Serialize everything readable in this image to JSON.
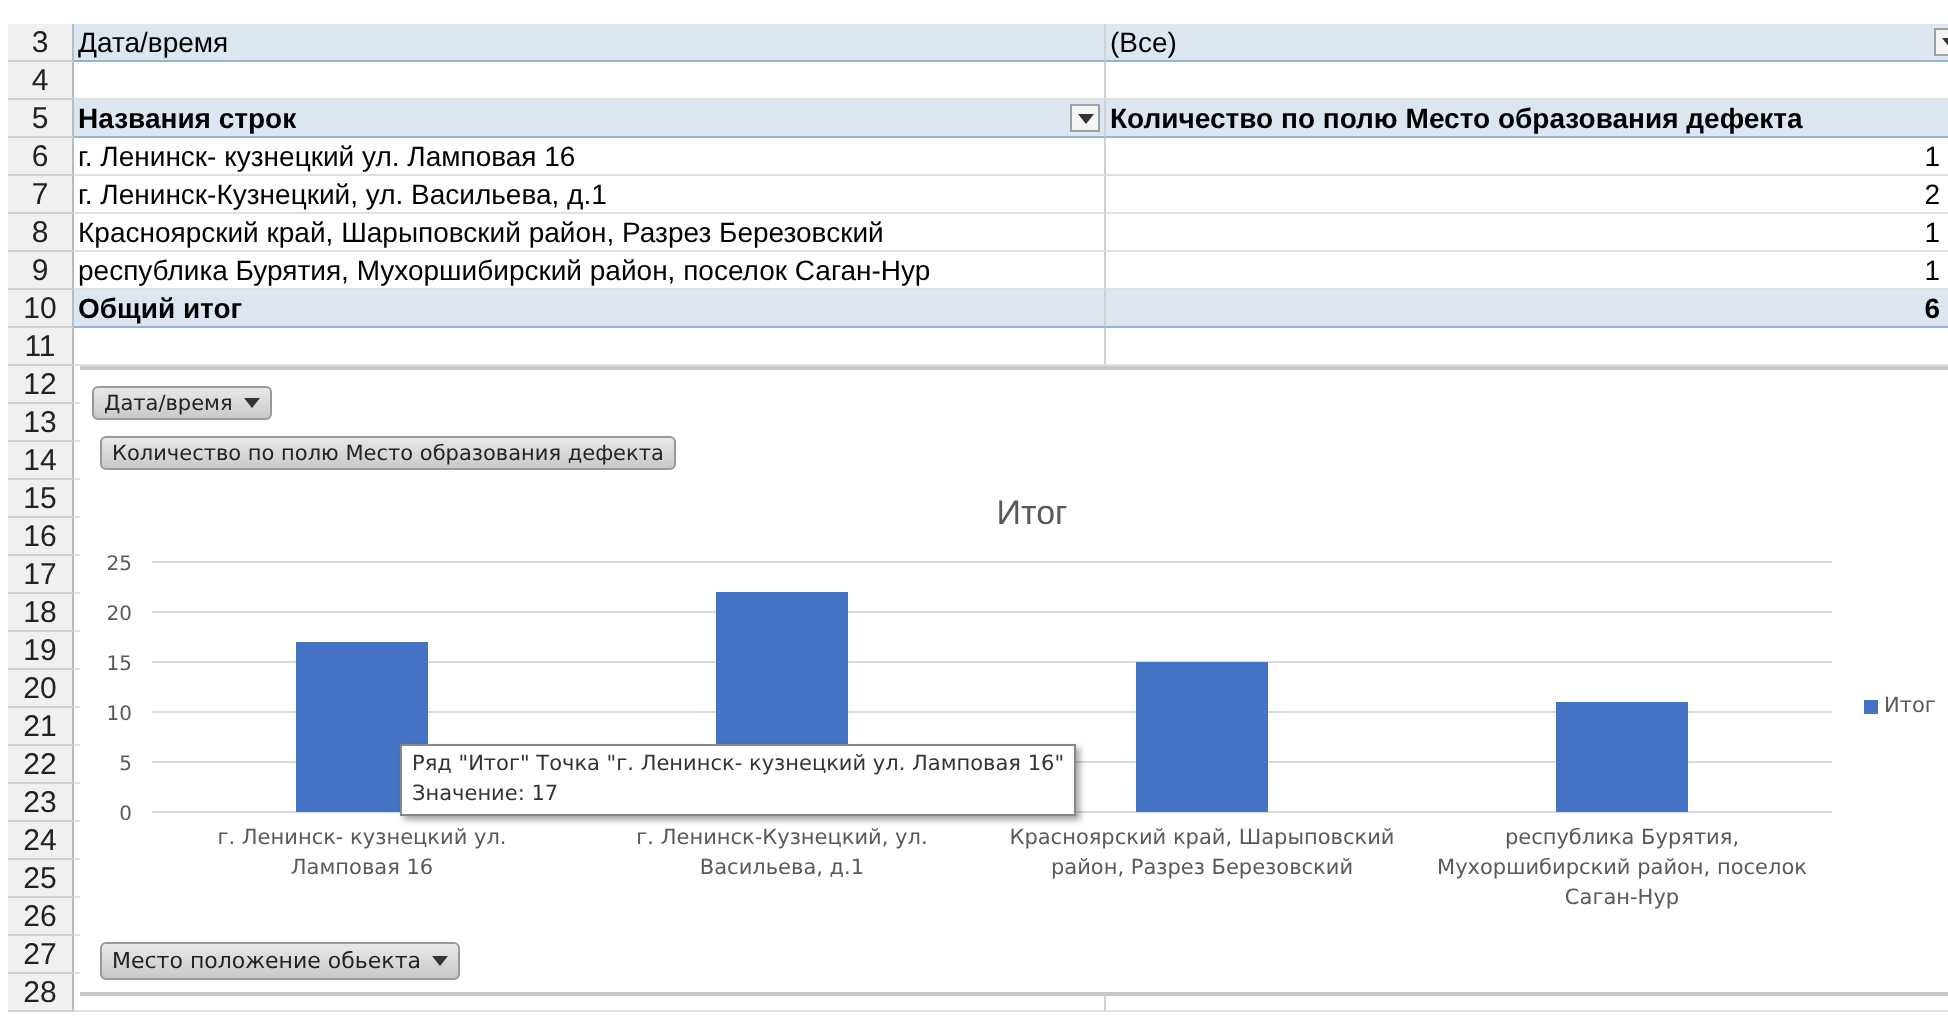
{
  "sheet": {
    "row_numbers": [
      "3",
      "4",
      "5",
      "6",
      "7",
      "8",
      "9",
      "10",
      "11",
      "12",
      "13",
      "14",
      "15",
      "16",
      "17",
      "18",
      "19",
      "20",
      "21",
      "22",
      "23",
      "24",
      "25",
      "26",
      "27",
      "28"
    ],
    "filter": {
      "label": "Дата/время",
      "value": "(Все)"
    },
    "header": {
      "row_label": "Названия строк",
      "value_label": "Количество по полю Место образования дефекта"
    },
    "rows": [
      {
        "label": "г. Ленинск- кузнецкий ул.  Ламповая 16",
        "value": "1"
      },
      {
        "label": "г. Ленинск-Кузнецкий, ул. Васильева, д.1",
        "value": "2"
      },
      {
        "label": "Красноярский край, Шарыповский район, Разрез Березовский",
        "value": "1"
      },
      {
        "label": "республика Бурятия, Мухоршибирский район, поселок Саган-Нур",
        "value": "1"
      }
    ],
    "total": {
      "label": "Общий итог",
      "value": "6"
    }
  },
  "pivot_chart": {
    "field_buttons": [
      {
        "label": "Дата/время",
        "dropdown": true
      },
      {
        "label": "Количество по полю Место образования дефекта",
        "dropdown": false
      }
    ],
    "chart_data": {
      "type": "bar",
      "title": "Итог",
      "categories": [
        "г. Ленинск- кузнецкий ул.  Ламповая 16",
        "г. Ленинск-Кузнецкий, ул. Васильева, д.1",
        "Красноярский край, Шарыповский район, Разрез Березовский",
        "республика Бурятия, Мухоршибирский район, поселок Саган-Нур"
      ],
      "series": [
        {
          "name": "Итог",
          "color": "#4472c4",
          "values": [
            17,
            22,
            15,
            11
          ]
        }
      ],
      "ylim": [
        0,
        25
      ],
      "grid": true,
      "yticks": [
        0,
        5,
        10,
        15,
        20,
        25
      ]
    },
    "tooltip": {
      "lines": [
        "Ряд \"Итог\" Точка \"г. Ленинск- кузнецкий ул.  Ламповая 16\"",
        "Значение: 17"
      ]
    },
    "axis_button": {
      "label": "Место положение обьекта",
      "dropdown": true
    }
  }
}
